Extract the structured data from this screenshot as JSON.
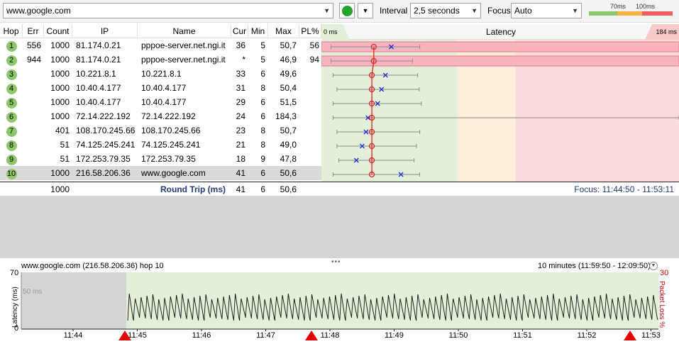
{
  "toolbar": {
    "target": "www.google.com",
    "interval_label": "Interval",
    "interval_value": "2,5 seconds",
    "focus_label": "Focus",
    "focus_value": "Auto",
    "scale_labels": [
      "70ms",
      "100ms"
    ],
    "scale_colors": [
      "#8dc66b",
      "#f6b043",
      "#f05f5f"
    ]
  },
  "table": {
    "columns": [
      "Hop",
      "Err",
      "Count",
      "IP",
      "Name",
      "Cur",
      "Min",
      "Max",
      "PL%"
    ],
    "rows": [
      {
        "hop": "1",
        "err": "556",
        "count": "1000",
        "ip": "81.174.0.21",
        "name": "pppoe-server.net.ngi.it",
        "cur": "36",
        "min": "5",
        "max": "50,7",
        "pl": "56",
        "avg": 27,
        "lo": 5,
        "hi": 50.7,
        "cur_v": 36
      },
      {
        "hop": "2",
        "err": "944",
        "count": "1000",
        "ip": "81.174.0.21",
        "name": "pppoe-server.net.ngi.it",
        "cur": "*",
        "min": "5",
        "max": "46,9",
        "pl": "94",
        "avg": 27,
        "lo": 5,
        "hi": 46.9,
        "cur_v": null
      },
      {
        "hop": "3",
        "err": "",
        "count": "1000",
        "ip": "10.221.8.1",
        "name": "10.221.8.1",
        "cur": "33",
        "min": "6",
        "max": "49,6",
        "pl": "",
        "avg": 26,
        "lo": 6,
        "hi": 49.6,
        "cur_v": 33
      },
      {
        "hop": "4",
        "err": "",
        "count": "1000",
        "ip": "10.40.4.177",
        "name": "10.40.4.177",
        "cur": "31",
        "min": "8",
        "max": "50,4",
        "pl": "",
        "avg": 26,
        "lo": 8,
        "hi": 50.4,
        "cur_v": 31
      },
      {
        "hop": "5",
        "err": "",
        "count": "1000",
        "ip": "10.40.4.177",
        "name": "10.40.4.177",
        "cur": "29",
        "min": "6",
        "max": "51,5",
        "pl": "",
        "avg": 26,
        "lo": 6,
        "hi": 51.5,
        "cur_v": 29
      },
      {
        "hop": "6",
        "err": "",
        "count": "1000",
        "ip": "72.14.222.192",
        "name": "72.14.222.192",
        "cur": "24",
        "min": "6",
        "max": "184,3",
        "pl": "",
        "avg": 26,
        "lo": 6,
        "hi": 184.3,
        "cur_v": 24
      },
      {
        "hop": "7",
        "err": "",
        "count": "401",
        "ip": "108.170.245.66",
        "name": "108.170.245.66",
        "cur": "23",
        "min": "8",
        "max": "50,7",
        "pl": "",
        "avg": 26,
        "lo": 8,
        "hi": 50.7,
        "cur_v": 23
      },
      {
        "hop": "8",
        "err": "",
        "count": "51",
        "ip": "74.125.245.241",
        "name": "74.125.245.241",
        "cur": "21",
        "min": "8",
        "max": "49,0",
        "pl": "",
        "avg": 26,
        "lo": 8,
        "hi": 49.0,
        "cur_v": 21
      },
      {
        "hop": "9",
        "err": "",
        "count": "51",
        "ip": "172.253.79.35",
        "name": "172.253.79.35",
        "cur": "18",
        "min": "9",
        "max": "47,8",
        "pl": "",
        "avg": 26,
        "lo": 9,
        "hi": 47.8,
        "cur_v": 18
      },
      {
        "hop": "10",
        "err": "",
        "count": "1000",
        "ip": "216.58.206.36",
        "name": "www.google.com",
        "cur": "41",
        "min": "6",
        "max": "50,6",
        "pl": "",
        "avg": 26,
        "lo": 6,
        "hi": 50.6,
        "cur_v": 41
      }
    ],
    "summary": {
      "count": "1000",
      "label": "Round Trip (ms)",
      "cur": "41",
      "min": "6",
      "max": "50,6"
    }
  },
  "latency": {
    "title": "Latency",
    "left_label": "0 ms",
    "right_label": "184 ms",
    "max_ms": 184.3,
    "zones": [
      70,
      100
    ],
    "focus_text": "Focus: 11:44:50 - 11:53:11"
  },
  "history": {
    "title": "www.google.com (216.58.206.36) hop 10",
    "range": "10 minutes (11:59:50 - 12:09:50)",
    "y_axis_label": "Latency (ms)",
    "y2_axis_label": "Packet Loss %",
    "y_max": "70",
    "y_max2": "30",
    "y_zero": "0",
    "mid_label": "50 ms",
    "x_ticks": [
      "11:44",
      "11:45",
      "11:46",
      "11:47",
      "11:48",
      "11:49",
      "11:50",
      "11:51",
      "11:52",
      "11:53"
    ],
    "loss_markers": [
      1,
      2,
      3
    ]
  }
}
